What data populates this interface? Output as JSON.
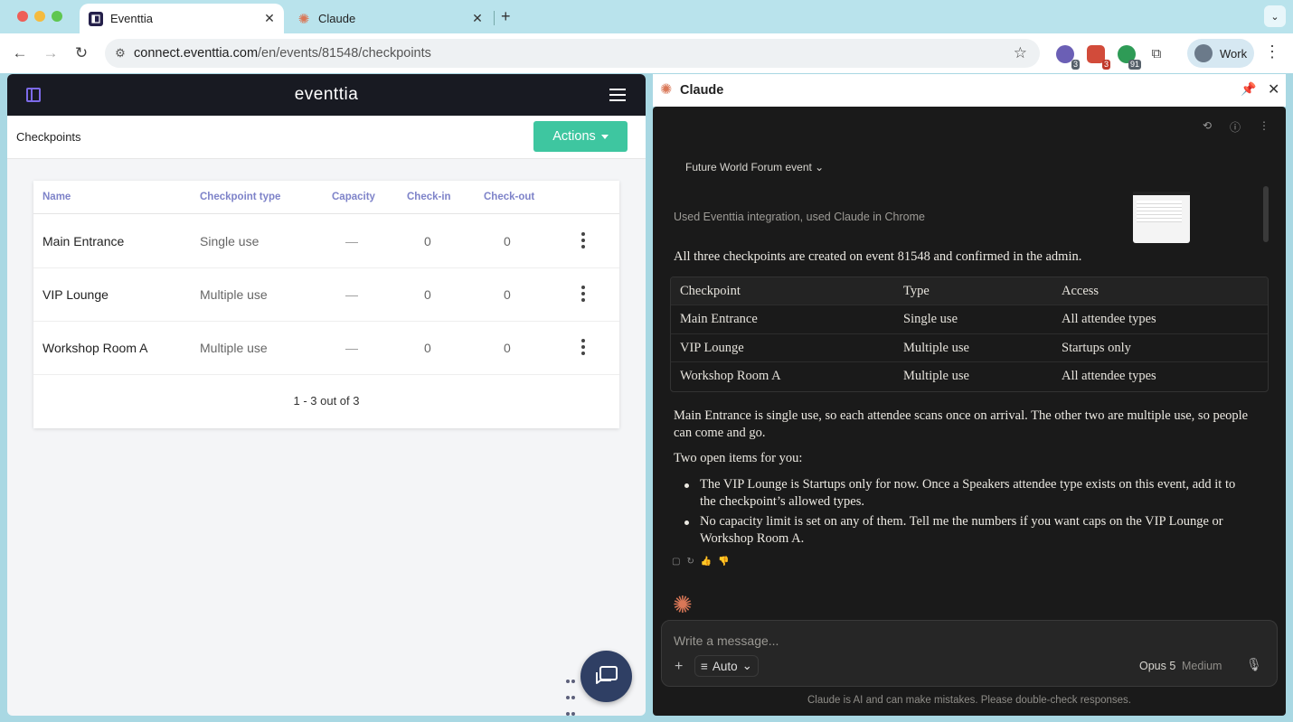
{
  "browser": {
    "tabs": [
      {
        "title": "Eventtia",
        "active": true
      },
      {
        "title": "Claude",
        "active": false
      }
    ],
    "url_host": "connect.eventtia.com",
    "url_path": "/en/events/81548/checkpoints",
    "extensions": [
      {
        "name": "extension-1",
        "badge": "3",
        "color": "#6b5fb5"
      },
      {
        "name": "extension-2",
        "badge": "3",
        "color": "#d24b3a"
      },
      {
        "name": "extension-3",
        "badge": "91",
        "color": "#2e9b56"
      }
    ],
    "profile_label": "Work"
  },
  "eventtia": {
    "logo": "eventtia",
    "breadcrumb": "Checkpoints",
    "actions_label": "Actions",
    "table": {
      "headers": [
        "Name",
        "Checkpoint type",
        "Capacity",
        "Check-in",
        "Check-out"
      ],
      "rows": [
        {
          "name": "Main Entrance",
          "type": "Single use",
          "capacity": "—",
          "checkin": "0",
          "checkout": "0"
        },
        {
          "name": "VIP Lounge",
          "type": "Multiple use",
          "capacity": "—",
          "checkin": "0",
          "checkout": "0"
        },
        {
          "name": "Workshop Room A",
          "type": "Multiple use",
          "capacity": "—",
          "checkin": "0",
          "checkout": "0"
        }
      ]
    },
    "pagination": "1 - 3 out of 3"
  },
  "claude": {
    "panel_title": "Claude",
    "project": "Future World Forum event",
    "tool_summary": "Used Eventtia integration, used Claude in Chrome",
    "intro": "All three checkpoints are created on event 81548 and confirmed in the admin.",
    "table": {
      "headers": [
        "Checkpoint",
        "Type",
        "Access"
      ],
      "rows": [
        [
          "Main Entrance",
          "Single use",
          "All attendee types"
        ],
        [
          "VIP Lounge",
          "Multiple use",
          "Startups only"
        ],
        [
          "Workshop Room A",
          "Multiple use",
          "All attendee types"
        ]
      ]
    },
    "paragraph": "Main Entrance is single use, so each attendee scans once on arrival. The other two are multiple use, so people can come and go.",
    "open_items_title": "Two open items for you:",
    "open_items": [
      "The VIP Lounge is Startups only for now. Once a Speakers attendee type exists on this event, add it to the checkpoint’s allowed types.",
      "No capacity limit is set on any of them. Tell me the numbers if you want caps on the VIP Lounge or Workshop Room A."
    ],
    "input_placeholder": "Write a message...",
    "mode_label": "Auto",
    "model": "Opus 5",
    "effort": "Medium",
    "disclaimer": "Claude is AI and can make mistakes. Please double-check responses."
  },
  "colors": {
    "accent_green": "#3ec6a0",
    "eventtia_header": "#181a22",
    "claude_orange": "#d97757",
    "header_purple": "#7e83c9"
  }
}
